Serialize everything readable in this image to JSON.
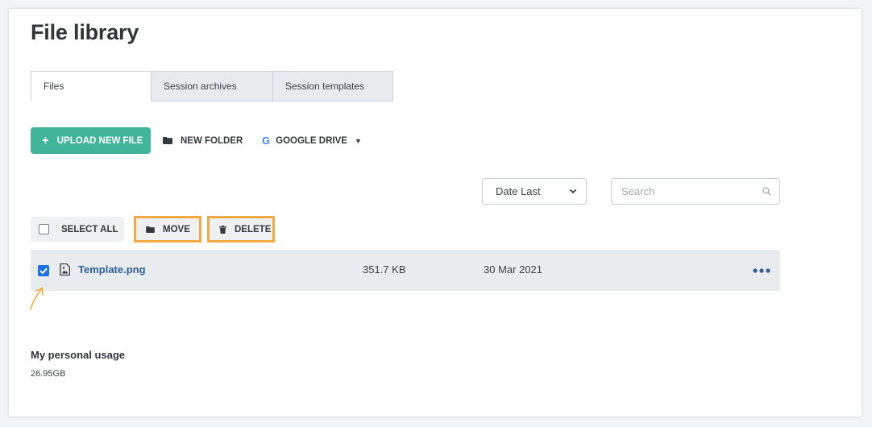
{
  "page": {
    "title": "File library"
  },
  "tabs": [
    {
      "label": "Files",
      "active": true
    },
    {
      "label": "Session archives",
      "active": false
    },
    {
      "label": "Session templates",
      "active": false
    }
  ],
  "toolbar": {
    "upload_label": "UPLOAD NEW FILE",
    "new_folder_label": "NEW FOLDER",
    "google_drive_label": "GOOGLE DRIVE",
    "google_icon": "G"
  },
  "sort": {
    "selected": "Date Last"
  },
  "search": {
    "placeholder": "Search",
    "value": ""
  },
  "actions": {
    "select_all_label": "SELECT ALL",
    "move_label": "MOVE",
    "delete_label": "DELETE",
    "highlight_color": "#f5a942"
  },
  "files": [
    {
      "name": "Template.png",
      "size": "351.7 KB",
      "date": "30 Mar 2021",
      "checked": true
    }
  ],
  "usage": {
    "title": "My personal usage",
    "value": "26.95GB"
  },
  "colors": {
    "accent": "#41b59a",
    "link": "#2f5f96",
    "checkbox": "#1f6fe5"
  }
}
